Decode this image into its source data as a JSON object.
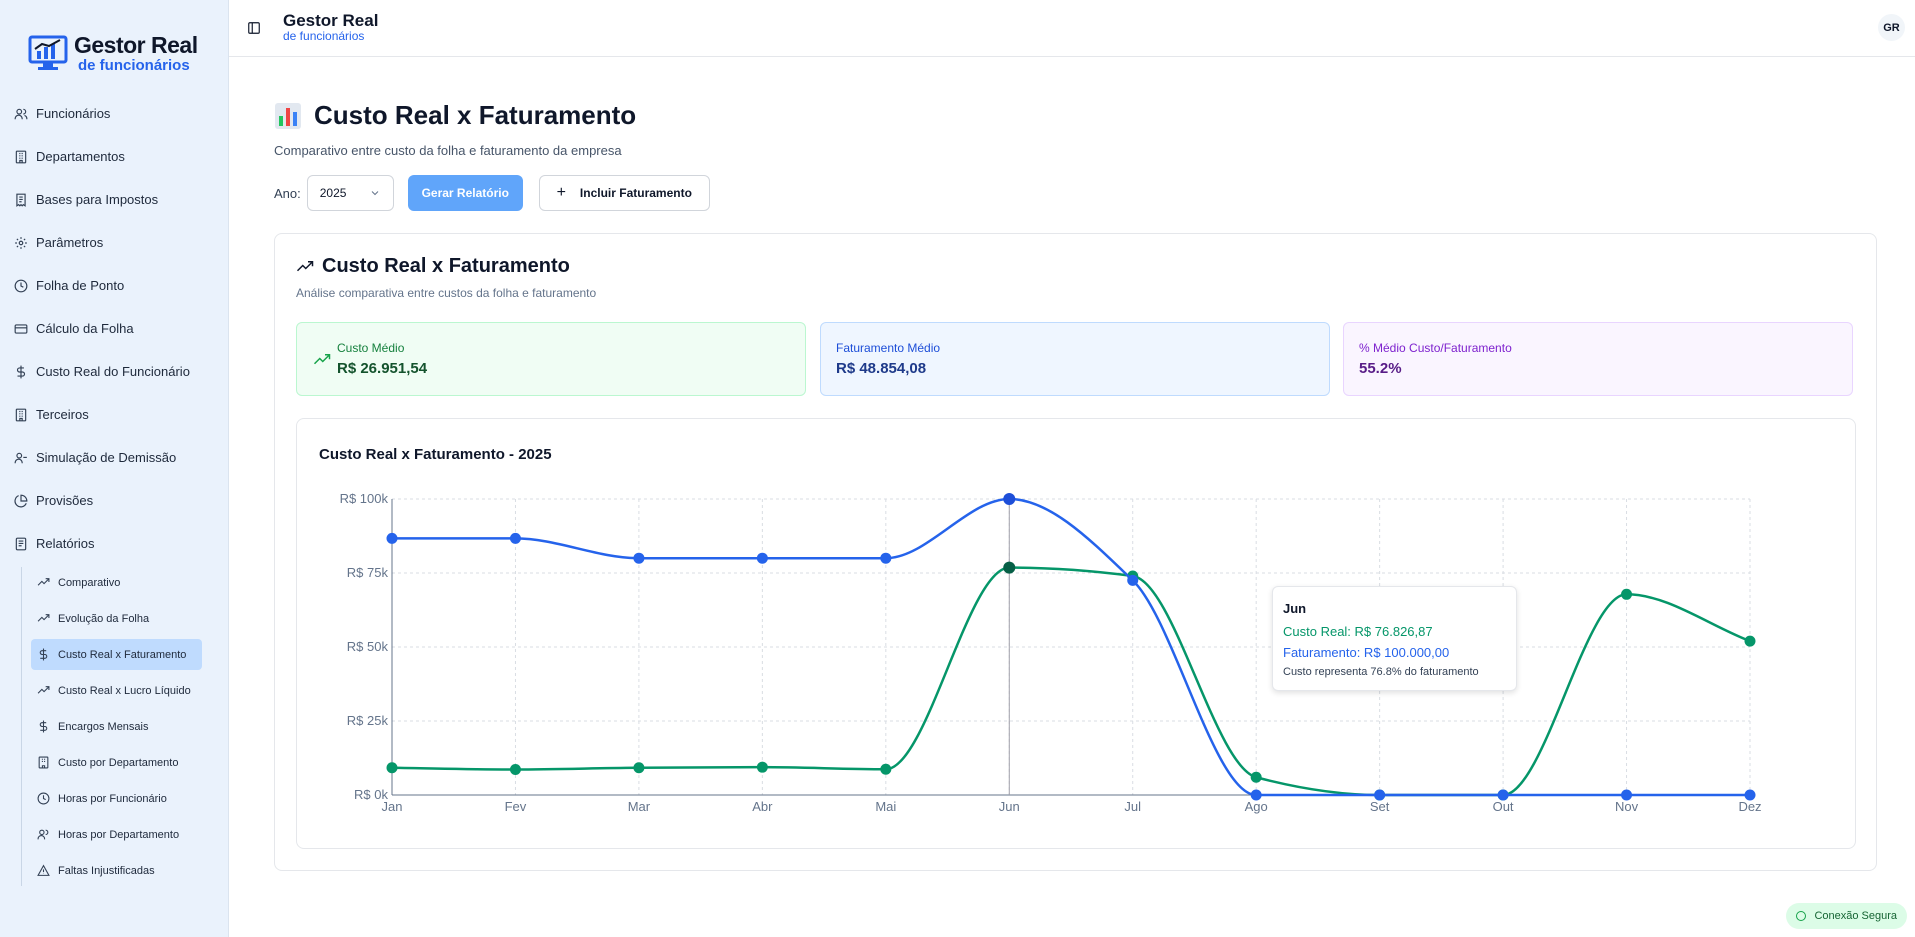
{
  "brand": {
    "name": "Gestor Real",
    "tagline": "de funcionários"
  },
  "sidebar": {
    "items": [
      {
        "label": "Funcionários",
        "icon": "users-icon"
      },
      {
        "label": "Departamentos",
        "icon": "building-icon"
      },
      {
        "label": "Bases para Impostos",
        "icon": "receipt-icon"
      },
      {
        "label": "Parâmetros",
        "icon": "gear-icon"
      },
      {
        "label": "Folha de Ponto",
        "icon": "clock-icon"
      },
      {
        "label": "Cálculo da Folha",
        "icon": "credit-card-icon"
      },
      {
        "label": "Custo Real do Funcionário",
        "icon": "dollar-icon"
      },
      {
        "label": "Terceiros",
        "icon": "building-icon"
      },
      {
        "label": "Simulação de Demissão",
        "icon": "user-minus-icon"
      },
      {
        "label": "Provisões",
        "icon": "pie-chart-icon"
      },
      {
        "label": "Relatórios",
        "icon": "file-icon"
      }
    ],
    "subitems": [
      {
        "label": "Comparativo",
        "icon": "trending-up-icon"
      },
      {
        "label": "Evolução da Folha",
        "icon": "trending-up-icon"
      },
      {
        "label": "Custo Real x Faturamento",
        "icon": "dollar-icon",
        "active": true
      },
      {
        "label": "Custo Real x Lucro Líquido",
        "icon": "trending-up-icon"
      },
      {
        "label": "Encargos Mensais",
        "icon": "dollar-icon"
      },
      {
        "label": "Custo por Departamento",
        "icon": "building-icon"
      },
      {
        "label": "Horas por Funcionário",
        "icon": "clock-icon"
      },
      {
        "label": "Horas por Departamento",
        "icon": "users-icon"
      },
      {
        "label": "Faltas Injustificadas",
        "icon": "alert-triangle-icon"
      }
    ]
  },
  "topbar": {
    "title": "Gestor Real",
    "subtitle": "de funcionários",
    "avatar": "GR"
  },
  "page": {
    "title": "Custo Real x Faturamento",
    "subtitle": "Comparativo entre custo da folha e faturamento da empresa",
    "year_label": "Ano:",
    "year_value": "2025",
    "generate_label": "Gerar Relatório",
    "add_label": "Incluir Faturamento"
  },
  "card": {
    "title": "Custo Real x Faturamento",
    "subtitle": "Análise comparativa entre custos da folha e faturamento",
    "stats": {
      "cost_label": "Custo Médio",
      "cost_value": "R$ 26.951,54",
      "revenue_label": "Faturamento Médio",
      "revenue_value": "R$ 48.854,08",
      "ratio_label": "% Médio Custo/Faturamento",
      "ratio_value": "55.2%"
    }
  },
  "tooltip": {
    "month": "Jun",
    "cost": "Custo Real: R$ 76.826,87",
    "revenue": "Faturamento: R$ 100.000,00",
    "pct": "Custo representa 76.8% do faturamento"
  },
  "status": {
    "secure_label": "Conexão Segura"
  },
  "colors": {
    "cost": "#059669",
    "revenue": "#2563eb",
    "accent": "#60a5fa"
  },
  "chart_data": {
    "type": "line",
    "title": "Custo Real x Faturamento - 2025",
    "categories": [
      "Jan",
      "Fev",
      "Mar",
      "Abr",
      "Mai",
      "Jun",
      "Jul",
      "Ago",
      "Set",
      "Out",
      "Nov",
      "Dez"
    ],
    "series": [
      {
        "key": "revenue",
        "values": [
          86700,
          86700,
          80000,
          80000,
          80000,
          100000,
          72500,
          0,
          0,
          0,
          0,
          0
        ]
      },
      {
        "key": "cost",
        "values": [
          9200,
          8600,
          9200,
          9400,
          8700,
          76826.87,
          74000,
          6000,
          0,
          0,
          67800,
          52000
        ]
      }
    ],
    "yticks": [
      "R$ 0k",
      "R$ 25k",
      "R$ 50k",
      "R$ 75k",
      "R$ 100k"
    ],
    "ylim": [
      0,
      100000
    ],
    "grid": true,
    "highlight_index": 5
  }
}
